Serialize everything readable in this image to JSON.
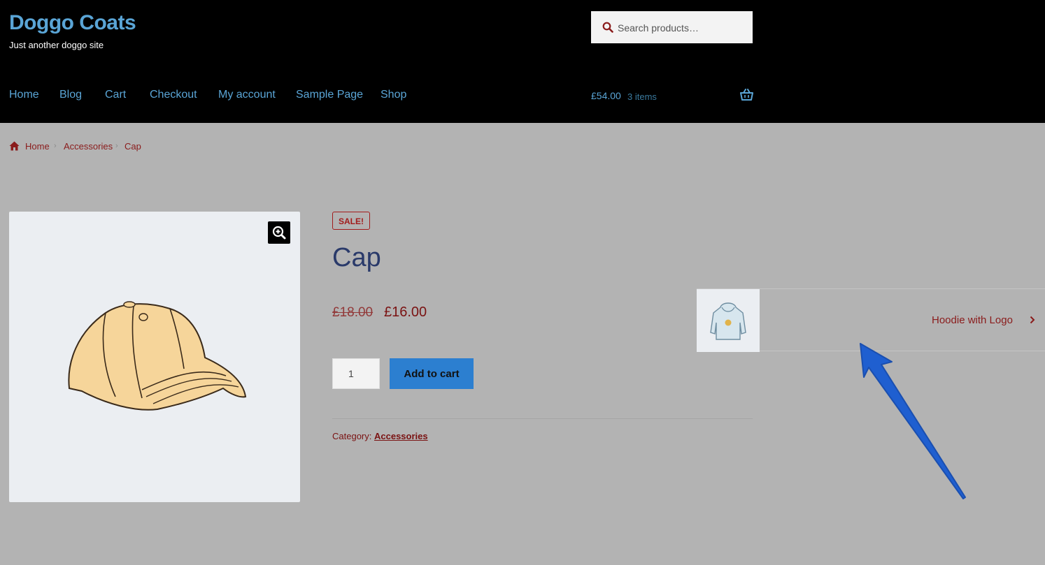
{
  "site": {
    "title": "Doggo Coats",
    "tagline": "Just another doggo site"
  },
  "search": {
    "placeholder": "Search products…",
    "icon": "search-icon"
  },
  "nav": {
    "items": [
      {
        "label": "Home"
      },
      {
        "label": "Blog"
      },
      {
        "label": "Cart"
      },
      {
        "label": "Checkout"
      },
      {
        "label": "My account"
      },
      {
        "label": "Sample Page"
      },
      {
        "label": "Shop"
      }
    ]
  },
  "cart": {
    "total": "£54.00",
    "count": "3 items",
    "icon": "basket-icon"
  },
  "breadcrumb": {
    "home": "Home",
    "category": "Accessories",
    "current": "Cap"
  },
  "product": {
    "badge": "SALE!",
    "title": "Cap",
    "price_old": "£18.00",
    "price_new": "£16.00",
    "quantity": "1",
    "add_to_cart_label": "Add to cart",
    "category_label": "Category:",
    "category_value": "Accessories"
  },
  "next_product": {
    "label": "Hoodie with Logo"
  },
  "colors": {
    "header_bg": "#000000",
    "link_blue": "#5aa5d6",
    "accent_red": "#8a1b1b",
    "button_blue": "#2c7fd0",
    "annotation_arrow": "#1f5fd0"
  }
}
